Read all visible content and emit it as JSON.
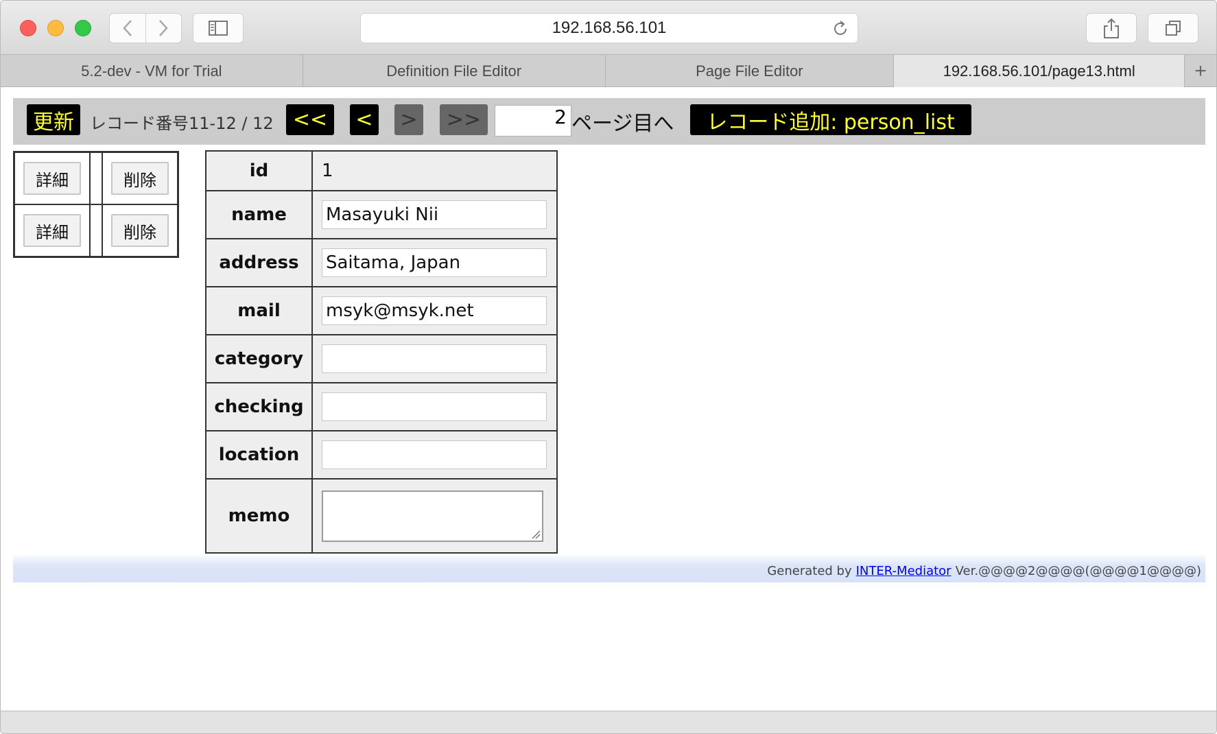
{
  "browser": {
    "url": "192.168.56.101",
    "tabs": [
      {
        "label": "5.2-dev - VM for Trial",
        "active": false
      },
      {
        "label": "Definition File Editor",
        "active": false
      },
      {
        "label": "Page File Editor",
        "active": false
      },
      {
        "label": "192.168.56.101/page13.html",
        "active": true
      }
    ],
    "new_tab_label": "+"
  },
  "navbar": {
    "refresh_label": "更新",
    "record_info": "レコード番号11-12 / 12",
    "first_label": "<<",
    "prev_label": "<",
    "next_label": ">",
    "last_label": ">>",
    "page_value": "2",
    "page_suffix": "ページ目へ",
    "add_record_label": "レコード追加: person_list"
  },
  "list": {
    "rows": [
      {
        "detail_label": "詳細",
        "delete_label": "削除"
      },
      {
        "detail_label": "詳細",
        "delete_label": "削除"
      }
    ]
  },
  "detail": {
    "fields": [
      {
        "label": "id",
        "value": "1"
      },
      {
        "label": "name",
        "value": "Masayuki Nii"
      },
      {
        "label": "address",
        "value": "Saitama, Japan"
      },
      {
        "label": "mail",
        "value": "msyk@msyk.net"
      },
      {
        "label": "category",
        "value": ""
      },
      {
        "label": "checking",
        "value": ""
      },
      {
        "label": "location",
        "value": ""
      },
      {
        "label": "memo",
        "value": ""
      }
    ]
  },
  "footer": {
    "prefix": "Generated by",
    "link_text": "INTER-Mediator",
    "version": "Ver.@@@@2@@@@(@@@@1@@@@)"
  },
  "colors": {
    "nav_button_bg": "#000000",
    "nav_button_text": "#ffff33",
    "nav_button_disabled": "#666666",
    "navbar_bg": "#cccccc",
    "footer_bg": "#d6e2f9",
    "link": "#0000ee"
  }
}
